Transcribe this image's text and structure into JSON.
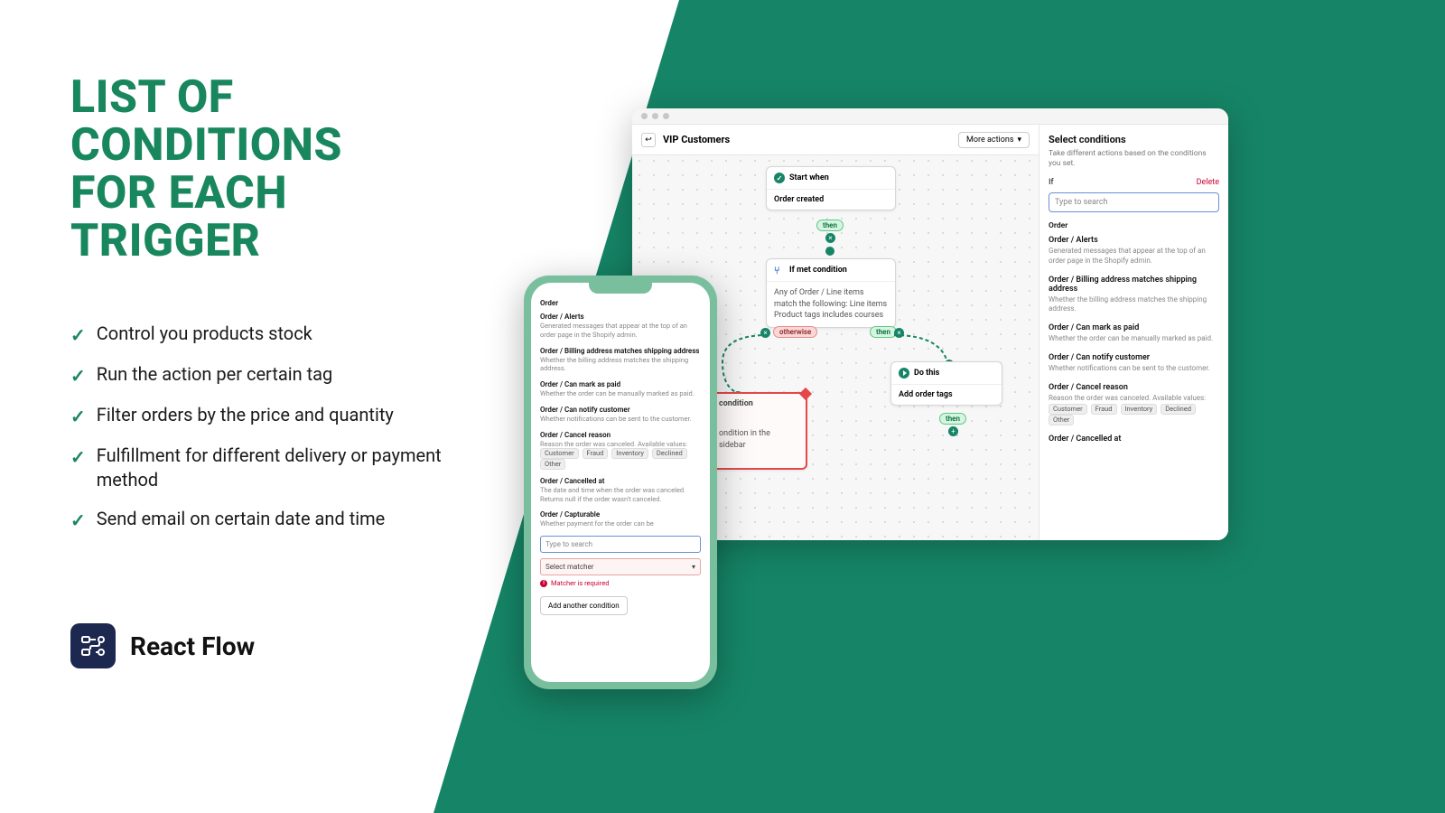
{
  "hero": {
    "headline_l1": "LIST OF",
    "headline_l2": "CONDITIONS",
    "headline_l3": "FOR EACH",
    "headline_l4": "TRIGGER",
    "bullets": [
      "Control you products stock",
      "Run the action per certain tag",
      "Filter orders by the price and quantity",
      "Fulfillment for different delivery or payment method",
      "Send email on certain date and time"
    ],
    "brand_name": "React Flow"
  },
  "desktop": {
    "workflow_title": "VIP Customers",
    "more_actions": "More actions",
    "start_node": {
      "head": "Start when",
      "body": "Order created"
    },
    "cond_node": {
      "head": "If met condition",
      "body": "Any of Order / Line items match the following: Line items Product tags includes courses"
    },
    "sel_node": {
      "head": "condition",
      "body": "ondition in the sidebar"
    },
    "action_node": {
      "head": "Do this",
      "body": "Add order tags"
    },
    "pills": {
      "then": "then",
      "otherwise": "otherwise"
    }
  },
  "sidebar": {
    "title": "Select conditions",
    "subtitle": "Take different actions based on the conditions you set.",
    "if_label": "If",
    "delete_label": "Delete",
    "search_placeholder": "Type to search",
    "section": "Order",
    "items": [
      {
        "title": "Order / Alerts",
        "desc": "Generated messages that appear at the top of an order page in the Shopify admin."
      },
      {
        "title": "Order / Billing address matches shipping address",
        "desc": "Whether the billing address matches the shipping address."
      },
      {
        "title": "Order / Can mark as paid",
        "desc": "Whether the order can be manually marked as paid."
      },
      {
        "title": "Order / Can notify customer",
        "desc": "Whether notifications can be sent to the customer."
      },
      {
        "title": "Order / Cancel reason",
        "desc": "Reason the order was canceled. Available values:",
        "tags": [
          "Customer",
          "Fraud",
          "Inventory",
          "Declined",
          "Other"
        ]
      },
      {
        "title": "Order / Cancelled at",
        "desc": ""
      }
    ]
  },
  "phone": {
    "section": "Order",
    "items": [
      {
        "title": "Order / Alerts",
        "desc": "Generated messages that appear at the top of an order page in the Shopify admin."
      },
      {
        "title": "Order / Billing address matches shipping address",
        "desc": "Whether the billing address matches the shipping address."
      },
      {
        "title": "Order / Can mark as paid",
        "desc": "Whether the order can be manually marked as paid."
      },
      {
        "title": "Order / Can notify customer",
        "desc": "Whether notifications can be sent to the customer."
      },
      {
        "title": "Order / Cancel reason",
        "desc": "Reason the order was canceled. Available values:",
        "tags": [
          "Customer",
          "Fraud",
          "Inventory",
          "Declined",
          "Other"
        ]
      },
      {
        "title": "Order / Cancelled at",
        "desc": "The date and time when the order was canceled. Returns null if the order wasn't canceled."
      },
      {
        "title": "Order / Capturable",
        "desc": "Whether payment for the order can be"
      }
    ],
    "search_placeholder": "Type to search",
    "matcher_placeholder": "Select matcher",
    "matcher_error": "Matcher is required",
    "add_another": "Add another condition"
  }
}
